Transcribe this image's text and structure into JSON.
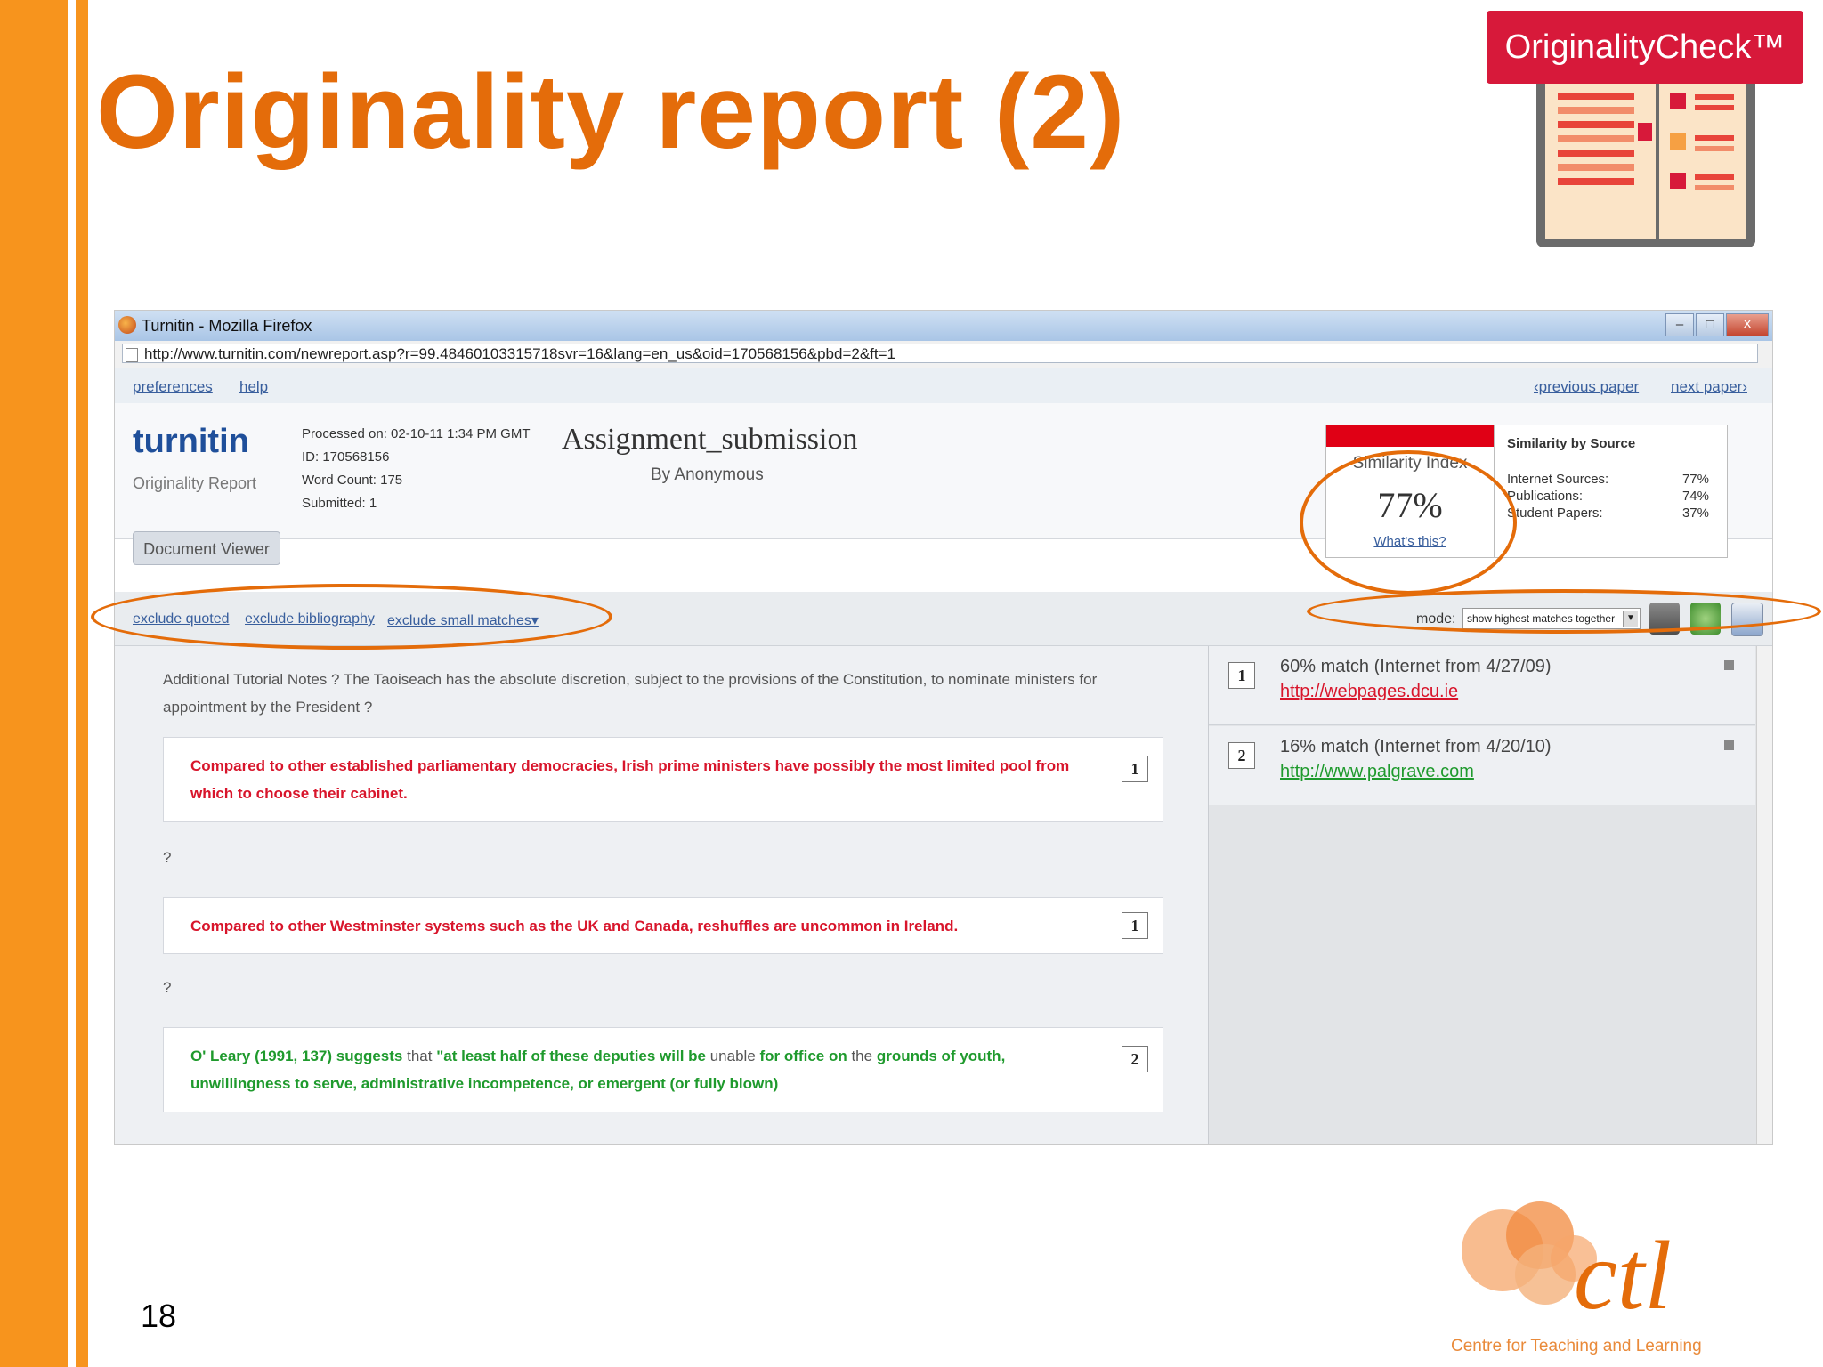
{
  "slide": {
    "title": "Originality report  (2)",
    "page_number": "18",
    "brand_badge": "OriginalityCheck™",
    "ctl_logo_text": "ctl",
    "ctl_caption": "Centre for Teaching and Learning",
    "accent_color": "#e46c0a",
    "bar_color": "#f7941d"
  },
  "browser": {
    "window_title": "Turnitin - Mozilla Firefox",
    "url": "http://www.turnitin.com/newreport.asp?r=99.48460103315718svr=16&lang=en_us&oid=170568156&pbd=2&ft=1",
    "buttons": {
      "minimize": "–",
      "maximize": "□",
      "close": "X"
    }
  },
  "nav": {
    "preferences": "preferences",
    "help": "help",
    "previous_paper": "‹previous paper",
    "next_paper": "next paper›"
  },
  "report": {
    "logo_main": "turnitin",
    "logo_sub": "Originality Report",
    "processed": "Processed on: 02-10-11 1:34 PM GMT",
    "id": "ID: 170568156",
    "word_count": "Word Count: 175",
    "submitted": "Submitted: 1",
    "title": "Assignment_submission",
    "author": "By Anonymous",
    "doc_viewer_button": "Document Viewer"
  },
  "similarity": {
    "label": "Similarity Index",
    "percent": "77%",
    "whats_this": "What's this?",
    "by_source_heading": "Similarity by Source",
    "sources": [
      {
        "label": "Internet Sources:",
        "value": "77%"
      },
      {
        "label": "Publications:",
        "value": "74%"
      },
      {
        "label": "Student Papers:",
        "value": "37%"
      }
    ]
  },
  "filters": {
    "exclude_quoted": "exclude quoted",
    "exclude_bibliography": "exclude bibliography",
    "exclude_small_matches": "exclude small matches▾",
    "mode_label": "mode:",
    "mode_value": "show highest matches together"
  },
  "document": {
    "intro": "Additional Tutorial Notes ? The Taoiseach has the absolute discretion, subject to the provisions of the Constitution, to nominate ministers for appointment by the President ?",
    "block1": "Compared to other established parliamentary democracies, Irish prime ministers have possibly the most limited pool from which to choose their cabinet.",
    "block1_num": "1",
    "q1": "?",
    "block2": "Compared to other Westminster systems such as the UK and Canada, reshuffles are uncommon in Ireland.",
    "block2_num": "1",
    "q2": "?",
    "block3_a": "O' Leary (1991, 137) suggests",
    "block3_b": " that ",
    "block3_c": "\"at least half of these deputies will be",
    "block3_d": " unable ",
    "block3_e": "for office on",
    "block3_f": " the ",
    "block3_g": "grounds of youth, unwillingness to serve, administrative incompetence, or emergent (or fully blown)",
    "block3_num": "2"
  },
  "matches": [
    {
      "num": "1",
      "text": "60% match (Internet from 4/27/09)",
      "link": "http://webpages.dcu.ie",
      "color": "#d8152b"
    },
    {
      "num": "2",
      "text": "16% match (Internet from 4/20/10)",
      "link": "http://www.palgrave.com",
      "color": "#1f9a2d"
    }
  ]
}
